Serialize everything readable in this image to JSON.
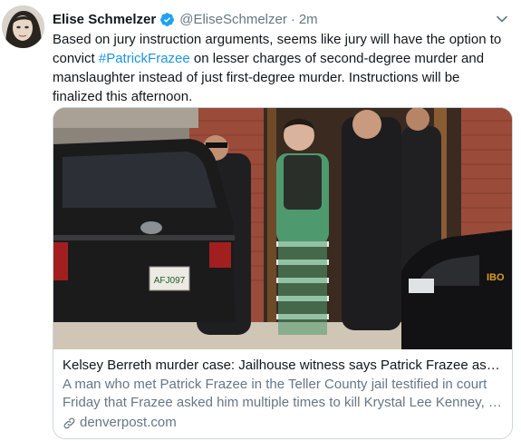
{
  "tweet": {
    "author": {
      "name": "Elise Schmelzer",
      "handle": "@EliseSchmelzer",
      "separator": "·",
      "time": "2m",
      "verified": true
    },
    "text": {
      "part1": "Based on jury instruction arguments, seems like jury will have the option to convict ",
      "hashtag": "#PatrickFrazee",
      "part2": " on lesser charges of second-degree murder and manslaughter instead of just first-degree murder. Instructions will be finalized this afternoon."
    },
    "card": {
      "title": "Kelsey Berreth murder case: Jailhouse witness says Patrick Frazee asked ...",
      "description_line1": "A man who met Patrick Frazee in the Teller County jail testified in court",
      "description_line2": "Friday that Frazee asked him multiple times to kill Krystal Lee Kenney, th...",
      "domain": "denverpost.com",
      "image_plate": "AFJ097",
      "image_badge": "IBO"
    },
    "icons": {
      "verified": "verified-badge-icon",
      "caret": "chevron-down-icon",
      "link": "link-icon"
    },
    "colors": {
      "accent": "#1da1f2",
      "hashtag": "#1b95e0",
      "muted": "#657786",
      "border": "#ccd6dd"
    }
  }
}
